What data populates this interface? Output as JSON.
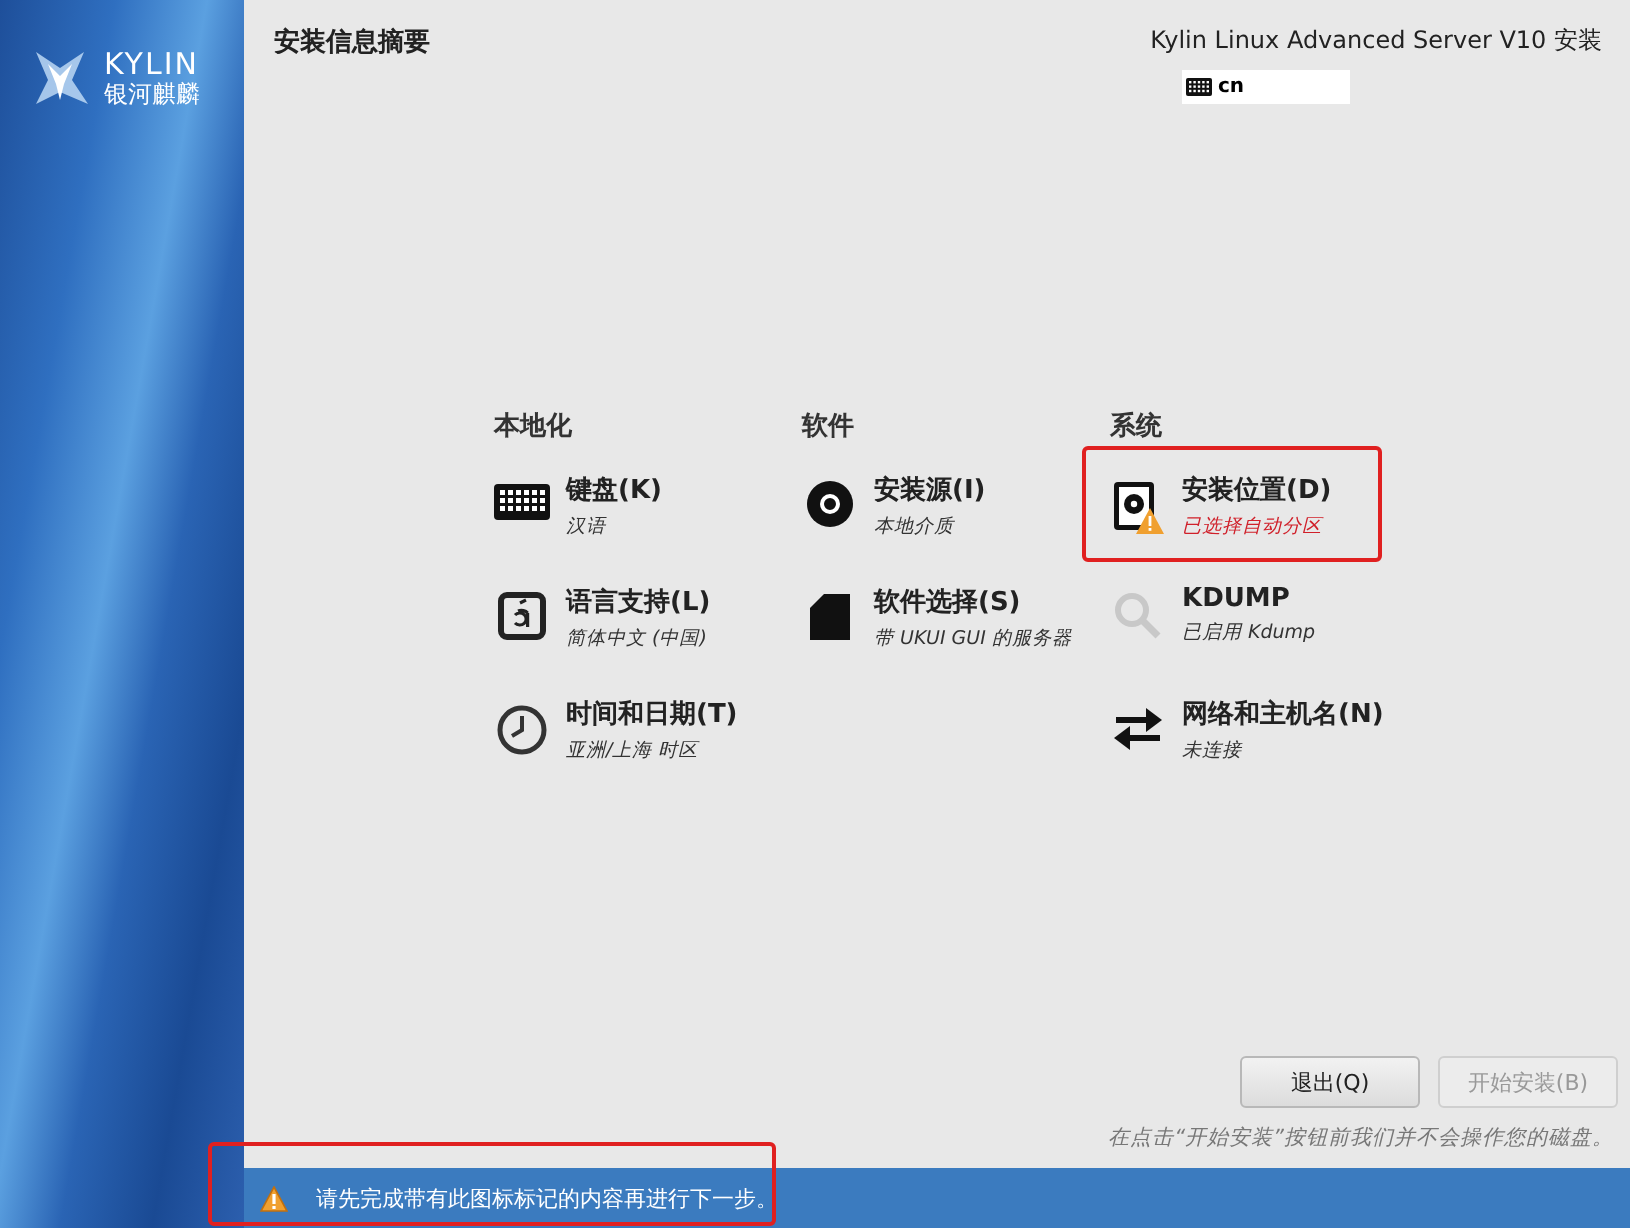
{
  "sidebar": {
    "logo_name": "KYLIN",
    "logo_subtitle": "银河麒麟"
  },
  "header": {
    "title": "安装信息摘要",
    "product": "Kylin Linux Advanced Server V10 安装",
    "keyboard_layout": "cn"
  },
  "categories": [
    {
      "title": "本地化",
      "spokes": [
        {
          "title": "键盘(K)",
          "status": "汉语",
          "warning": false,
          "highlighted": false
        },
        {
          "title": "语言支持(L)",
          "status": "简体中文 (中国)",
          "warning": false,
          "highlighted": false
        },
        {
          "title": "时间和日期(T)",
          "status": "亚洲/上海 时区",
          "warning": false,
          "highlighted": false
        }
      ]
    },
    {
      "title": "软件",
      "spokes": [
        {
          "title": "安装源(I)",
          "status": "本地介质",
          "warning": false,
          "highlighted": false
        },
        {
          "title": "软件选择(S)",
          "status": "带 UKUI GUI 的服务器",
          "warning": false,
          "highlighted": false
        }
      ]
    },
    {
      "title": "系统",
      "spokes": [
        {
          "title": "安装位置(D)",
          "status": "已选择自动分区",
          "warning": true,
          "highlighted": true
        },
        {
          "title": "KDUMP",
          "status": "已启用 Kdump",
          "warning": false,
          "highlighted": false
        },
        {
          "title": "网络和主机名(N)",
          "status": "未连接",
          "warning": false,
          "highlighted": false
        }
      ]
    }
  ],
  "buttons": [
    {
      "label": "退出(Q)",
      "disabled": false
    },
    {
      "label": "开始安装(B)",
      "disabled": true
    }
  ],
  "footer_note": "在点击“开始安装”按钮前我们并不会操作您的磁盘。",
  "warning_bar": {
    "text": "请先完成带有此图标标记的内容再进行下一步。",
    "highlighted": true
  }
}
